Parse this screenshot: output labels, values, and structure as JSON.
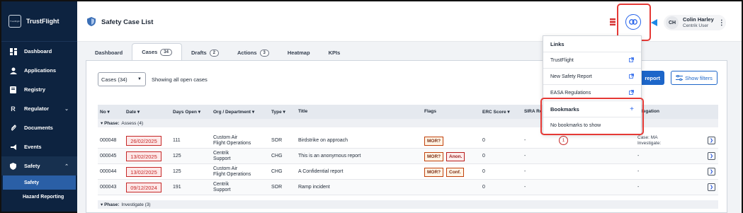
{
  "app": {
    "brand_name": "TrustFlight",
    "logo_text": "TrustFlight"
  },
  "sidebar": {
    "items": [
      {
        "label": "Dashboard",
        "icon": "dashboard-icon"
      },
      {
        "label": "Applications",
        "icon": "person-icon"
      },
      {
        "label": "Registry",
        "icon": "book-icon"
      },
      {
        "label": "Regulator",
        "icon": "letter-r-icon",
        "glyph": "R"
      },
      {
        "label": "Documents",
        "icon": "paperclip-icon"
      },
      {
        "label": "Events",
        "icon": "megaphone-icon"
      },
      {
        "label": "Safety",
        "icon": "shield-icon"
      }
    ],
    "sub_items": [
      {
        "label": "Safety"
      },
      {
        "label": "Hazard Reporting"
      }
    ]
  },
  "header": {
    "title": "Safety Case List",
    "user": {
      "initials": "CH",
      "name": "Colin Harley",
      "role": "Centrik User"
    }
  },
  "tabs": [
    {
      "label": "Dashboard"
    },
    {
      "label": "Cases",
      "count": "34"
    },
    {
      "label": "Drafts",
      "count": "2"
    },
    {
      "label": "Actions",
      "count": "3"
    },
    {
      "label": "Heatmap"
    },
    {
      "label": "KPIs"
    }
  ],
  "toolbar": {
    "select_value": "Cases (34)",
    "showing_text": "Showing all open cases",
    "report_label": "report",
    "filters_label": "Show filters"
  },
  "table": {
    "headers": [
      "No",
      "Date",
      "Days Open",
      "Org / Department",
      "Type",
      "Title",
      "Flags",
      "ERC Score",
      "SIRA Re",
      "legation"
    ],
    "phase_assess": {
      "label": "Phase:",
      "name": "Assess (4)"
    },
    "phase_investigate": {
      "label": "Phase:",
      "name": "Investigate (3)"
    },
    "rows": [
      {
        "no": "000048",
        "date": "26/02/2025",
        "days": "111",
        "org1": "Custom Air",
        "org2": "Flight Operations",
        "type": "SOR",
        "title": "Birdstrike on approach",
        "flags": [
          "MOR?"
        ],
        "erc": "0",
        "sira": "-",
        "count": "1",
        "deleg1": "Case:  MA",
        "deleg2": "Investigate:"
      },
      {
        "no": "000045",
        "date": "13/02/2025",
        "days": "125",
        "org1": "Centrik",
        "org2": "Support",
        "type": "CHG",
        "title": "This is an anonymous report",
        "flags": [
          "MOR?",
          "Anon."
        ],
        "erc": "0",
        "sira": "-",
        "deleg1": "-"
      },
      {
        "no": "000044",
        "date": "13/02/2025",
        "days": "125",
        "org1": "Custom Air",
        "org2": "Flight Operations",
        "type": "CHG",
        "title": "A Confidential report",
        "flags": [
          "MOR?",
          "Conf."
        ],
        "erc": "0",
        "sira": "-",
        "deleg1": "-"
      },
      {
        "no": "000043",
        "date": "09/12/2024",
        "days": "191",
        "org1": "Centrik",
        "org2": "Support",
        "type": "SOR",
        "title": "Ramp incident",
        "flags": [],
        "erc": "0",
        "sira": "-",
        "deleg1": "-"
      }
    ]
  },
  "popover": {
    "links_title": "Links",
    "links": [
      {
        "label": "TrustFlight"
      },
      {
        "label": "New Safety Report"
      },
      {
        "label": "EASA Regulations"
      }
    ],
    "bookmarks_title": "Bookmarks",
    "bookmarks_empty": "No bookmarks to show"
  },
  "colors": {
    "sidebar_bg": "#0d2340",
    "accent": "#1d66c9",
    "highlight": "#e53935",
    "overdue": "#c62828"
  }
}
